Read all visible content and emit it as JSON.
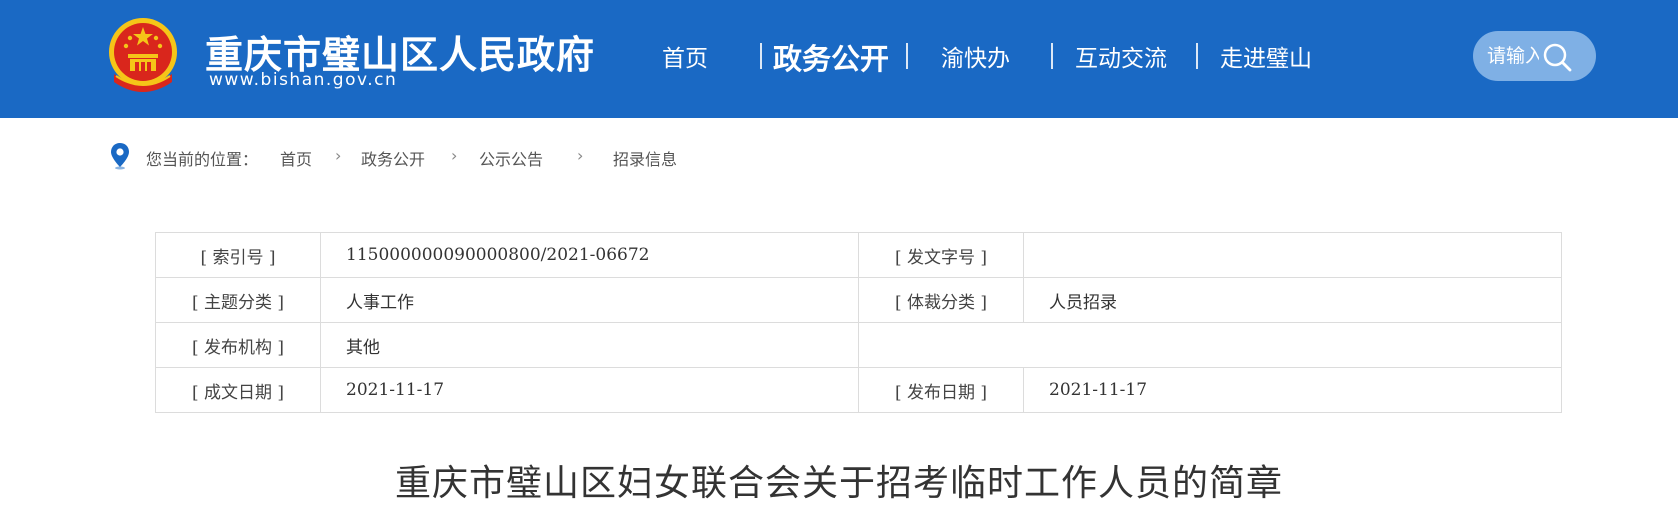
{
  "header": {
    "title": "重庆市璧山区人民政府",
    "url": "www.bishan.gov.cn",
    "colors": {
      "background": "#1a69c4",
      "emblem_red": "#d9261c",
      "emblem_gold": "#f5c518"
    }
  },
  "nav": {
    "items": [
      {
        "label": "首页"
      },
      {
        "label": "政务公开"
      },
      {
        "label": "渝快办"
      },
      {
        "label": "互动交流"
      },
      {
        "label": "走进璧山"
      }
    ],
    "active_index": 1
  },
  "search": {
    "placeholder": "请输入"
  },
  "breadcrumb": {
    "prefix": "您当前的位置：",
    "items": [
      "首页",
      "政务公开",
      "公示公告",
      "招录信息"
    ]
  },
  "meta": {
    "rows": [
      [
        {
          "label": "[ 索引号 ]",
          "value": "115000000090000800/2021-06672"
        },
        {
          "label": "[ 发文字号 ]",
          "value": ""
        }
      ],
      [
        {
          "label": "[ 主题分类 ]",
          "value": "人事工作"
        },
        {
          "label": "[ 体裁分类 ]",
          "value": "人员招录"
        }
      ],
      [
        {
          "label": "[ 发布机构 ]",
          "value": "其他"
        }
      ],
      [
        {
          "label": "[ 成文日期 ]",
          "value": "2021-11-17"
        },
        {
          "label": "[ 发布日期 ]",
          "value": "2021-11-17"
        }
      ]
    ]
  },
  "article": {
    "title": "重庆市璧山区妇女联合会关于招考临时工作人员的简章"
  }
}
